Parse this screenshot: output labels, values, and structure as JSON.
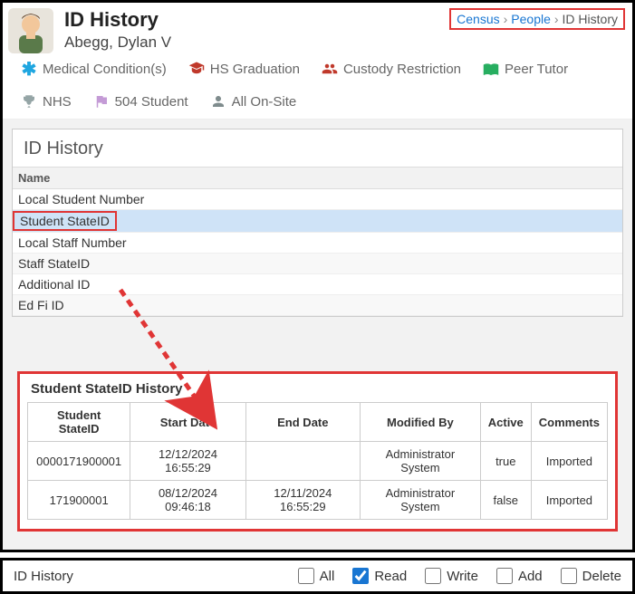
{
  "header": {
    "title": "ID History",
    "person_name": "Abegg, Dylan V"
  },
  "breadcrumb": {
    "items": [
      "Census",
      "People",
      "ID History"
    ]
  },
  "flags": [
    {
      "icon": "asterisk-icon",
      "label": "Medical Condition(s)"
    },
    {
      "icon": "graduation-cap-icon",
      "label": "HS Graduation"
    },
    {
      "icon": "people-icon",
      "label": "Custody Restriction"
    },
    {
      "icon": "book-icon",
      "label": "Peer Tutor"
    },
    {
      "icon": "trophy-icon",
      "label": "NHS"
    },
    {
      "icon": "flag-icon",
      "label": "504 Student"
    },
    {
      "icon": "user-icon",
      "label": "All On-Site"
    }
  ],
  "panel": {
    "title": "ID History",
    "col_header": "Name",
    "rows": [
      "Local Student Number",
      "Student StateID",
      "Local Staff Number",
      "Staff StateID",
      "Additional ID",
      "Ed Fi ID"
    ],
    "selected_index": 1
  },
  "detail": {
    "title": "Student StateID History",
    "columns": [
      "Student StateID",
      "Start Date",
      "End Date",
      "Modified By",
      "Active",
      "Comments"
    ],
    "rows": [
      {
        "id": "0000171900001",
        "start": "12/12/2024 16:55:29",
        "end": "",
        "by": "Administrator System",
        "active": "true",
        "comments": "Imported"
      },
      {
        "id": "171900001",
        "start": "08/12/2024 09:46:18",
        "end": "12/11/2024 16:55:29",
        "by": "Administrator System",
        "active": "false",
        "comments": "Imported"
      }
    ]
  },
  "permissions": {
    "label": "ID History",
    "options": [
      {
        "name": "All",
        "checked": false
      },
      {
        "name": "Read",
        "checked": true
      },
      {
        "name": "Write",
        "checked": false
      },
      {
        "name": "Add",
        "checked": false
      },
      {
        "name": "Delete",
        "checked": false
      }
    ]
  }
}
